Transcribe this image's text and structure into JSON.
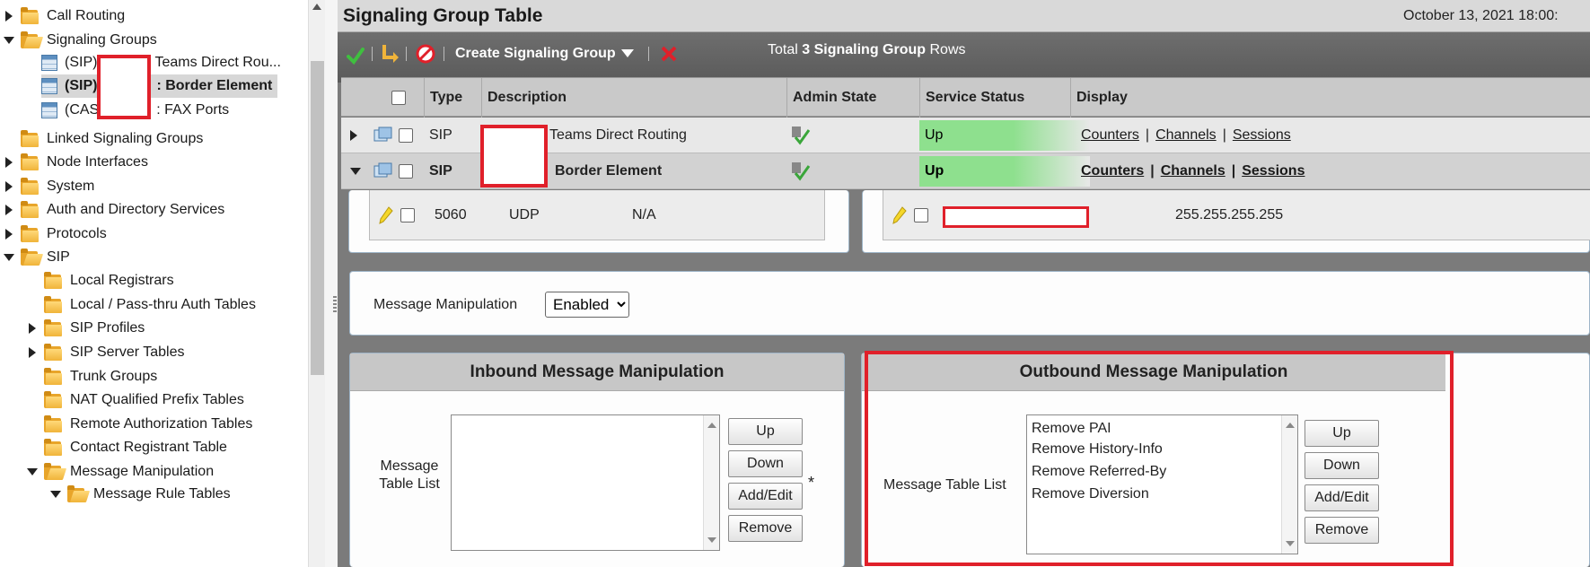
{
  "tree": {
    "items": [
      {
        "label": "Call Routing"
      },
      {
        "label": "Signaling Groups"
      },
      {
        "label": "(SIP)",
        "suffix": "Teams Direct Rou..."
      },
      {
        "label": "(SIP)",
        "suffix": ": Border Element"
      },
      {
        "label": "(CAS",
        "suffix": ": FAX Ports"
      },
      {
        "label": "Linked Signaling Groups"
      },
      {
        "label": "Node Interfaces"
      },
      {
        "label": "System"
      },
      {
        "label": "Auth and Directory Services"
      },
      {
        "label": "Protocols"
      },
      {
        "label": "SIP"
      },
      {
        "label": "Local Registrars"
      },
      {
        "label": "Local / Pass-thru Auth Tables"
      },
      {
        "label": "SIP Profiles"
      },
      {
        "label": "SIP Server Tables"
      },
      {
        "label": "Trunk Groups"
      },
      {
        "label": "NAT Qualified Prefix Tables"
      },
      {
        "label": "Remote Authorization Tables"
      },
      {
        "label": "Contact Registrant Table"
      },
      {
        "label": "Message Manipulation"
      },
      {
        "label": "Message Rule Tables"
      }
    ]
  },
  "header": {
    "title": "Signaling Group Table",
    "date": "October 13, 2021 18:00:"
  },
  "toolbar": {
    "create_label": "Create Signaling Group",
    "total_prefix": "Total",
    "total_count": "3 Signaling Group",
    "total_suffix": "Rows"
  },
  "grid": {
    "columns": [
      "Type",
      "Description",
      "Admin State",
      "Service Status",
      "Display"
    ],
    "rows": [
      {
        "type": "SIP",
        "description": "Teams Direct Routing",
        "service_status": "Up",
        "links": [
          "Counters",
          "Channels",
          "Sessions"
        ]
      },
      {
        "type": "SIP",
        "description": "Border Element",
        "service_status": "Up",
        "links": [
          "Counters",
          "Channels",
          "Sessions"
        ]
      }
    ]
  },
  "subrows": {
    "port": "5060",
    "protocol": "UDP",
    "tls": "N/A",
    "mask": "255.255.255.255"
  },
  "manipulation": {
    "label": "Message Manipulation",
    "value": "Enabled",
    "options": [
      "Enabled"
    ]
  },
  "inbound": {
    "title": "Inbound Message Manipulation",
    "list_label": "Message Table List",
    "items": [],
    "asterisk": "*"
  },
  "outbound": {
    "title": "Outbound Message Manipulation",
    "list_label": "Message Table List",
    "items": [
      "Remove PAI",
      "Remove History-Info",
      "Remove Referred-By",
      "Remove Diversion"
    ]
  },
  "buttons": {
    "up": "Up",
    "down": "Down",
    "add_edit": "Add/Edit",
    "remove": "Remove"
  },
  "colors": {
    "status_up": "#8ee08e",
    "highlight": "#e0202a",
    "folder": "#f0b43a"
  }
}
